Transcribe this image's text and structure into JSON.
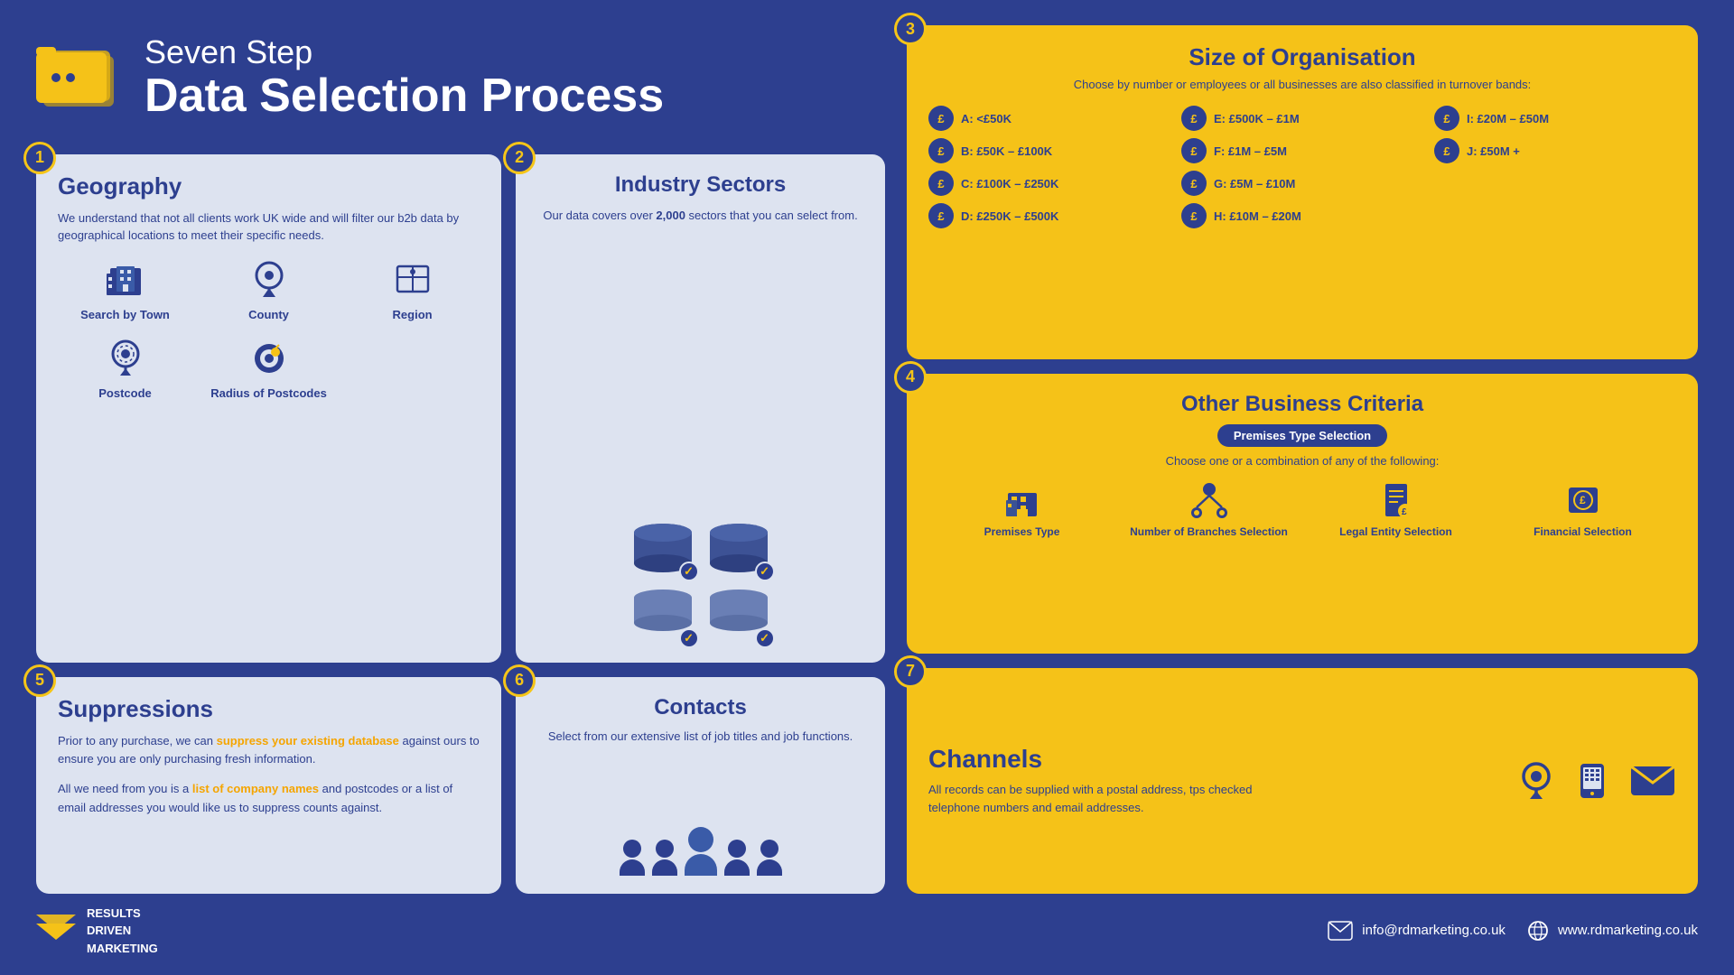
{
  "page": {
    "background": "#2d3f8f",
    "title": "Seven Step Data Selection Process"
  },
  "header": {
    "line1": "Seven Step",
    "line2": "Data Selection Process"
  },
  "step1": {
    "number": "1",
    "title": "Geography",
    "description": "We understand that not all clients work UK wide and will filter our b2b data by geographical locations to meet their specific needs.",
    "items": [
      {
        "label": "Search by Town",
        "icon": "building"
      },
      {
        "label": "County",
        "icon": "map-pin"
      },
      {
        "label": "Region",
        "icon": "map"
      },
      {
        "label": "Postcode",
        "icon": "postcode"
      },
      {
        "label": "Radius of Postcodes",
        "icon": "radius"
      }
    ]
  },
  "step2": {
    "number": "2",
    "title": "Industry Sectors",
    "description": "Our data covers over 2,000 sectors that you can select from.",
    "highlight": "2,000"
  },
  "step3": {
    "number": "3",
    "title": "Size of Organisation",
    "subtitle": "Choose by number or employees or all businesses are also classified in turnover bands:",
    "bands": [
      {
        "letter": "A",
        "label": "A: <£50K"
      },
      {
        "letter": "E",
        "label": "E: £500K – £1M"
      },
      {
        "letter": "I",
        "label": "I: £20M – £50M"
      },
      {
        "letter": "B",
        "label": "B: £50K – £100K"
      },
      {
        "letter": "F",
        "label": "F: £1M – £5M"
      },
      {
        "letter": "J",
        "label": "J: £50M +"
      },
      {
        "letter": "C",
        "label": "C: £100K – £250K"
      },
      {
        "letter": "G",
        "label": "G: £5M – £10M"
      },
      {
        "letter": "D",
        "label": "D: £250K – £500K"
      },
      {
        "letter": "H",
        "label": "H: £10M – £20M"
      }
    ]
  },
  "step4": {
    "number": "4",
    "title": "Other Business Criteria",
    "badge": "Premises Type Selection",
    "subtitle": "Choose one or a combination of any of the following:",
    "criteria": [
      {
        "label": "Premises Type",
        "icon": "building"
      },
      {
        "label": "Number of Branches Selection",
        "icon": "branches"
      },
      {
        "label": "Legal Entity Selection",
        "icon": "legal"
      },
      {
        "label": "Financial Selection",
        "icon": "financial"
      }
    ]
  },
  "step5": {
    "number": "5",
    "title": "Suppressions",
    "description1": "Prior to any purchase, we can suppress your existing database against ours to ensure you are only purchasing fresh information.",
    "description2": "All we need from you is a list of company names and postcodes or a list of email addresses you would like us to suppress counts against.",
    "highlight1": "suppress your existing database",
    "highlight2": "list of company names"
  },
  "step6": {
    "number": "6",
    "title": "Contacts",
    "description": "Select from our extensive list of job titles and job functions."
  },
  "step7": {
    "number": "7",
    "title": "Channels",
    "description": "All records can be supplied with a postal address, tps checked telephone numbers and email addresses."
  },
  "footer": {
    "logo_line1": "RESULTS",
    "logo_line2": "DRIVEN",
    "logo_line3": "MARKETING",
    "email_icon": "✉",
    "email": "info@rdmarketing.co.uk",
    "web_icon": "🌐",
    "website": "www.rdmarketing.co.uk"
  }
}
